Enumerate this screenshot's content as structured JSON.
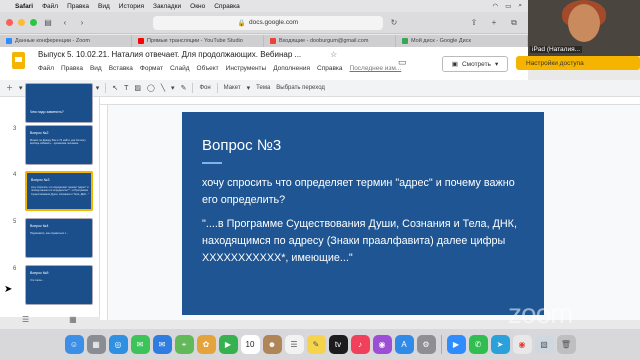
{
  "menubar": {
    "apple": "",
    "app": "Safari",
    "items": [
      "Файл",
      "Правка",
      "Вид",
      "История",
      "Закладки",
      "Окно",
      "Справка"
    ]
  },
  "safari": {
    "url": "docs.google.com",
    "lock_icon": "lock-icon"
  },
  "tabs": [
    {
      "label": "Данные конференции - Zoom",
      "color": "#2d8cff"
    },
    {
      "label": "Прямые трансляции - YouTube Studio",
      "color": "#ff0000"
    },
    {
      "label": "Входящие - dooburgum@gmail.com",
      "color": "#ea4335"
    },
    {
      "label": "Мой диск - Google Диск",
      "color": "#34a853"
    }
  ],
  "docs": {
    "title": "Выпуск 5. 10.02.21. Наталия отвечает. Для продолжающих. Вебинар ...",
    "menus": [
      "Файл",
      "Правка",
      "Вид",
      "Вставка",
      "Формат",
      "Слайд",
      "Объект",
      "Инструменты",
      "Дополнения",
      "Справка"
    ],
    "last_edit": "Последнее изм...",
    "view_button": "Смотреть",
    "access_button": "Настройки доступа"
  },
  "toolbar": {
    "background": "Фон",
    "layout": "Макет",
    "theme": "Тема",
    "transition": "Выбрать переход"
  },
  "filmstrip": {
    "slides": [
      {
        "num": "",
        "title": "",
        "body": "Чем надо заменить?",
        "selected": false
      },
      {
        "num": "3",
        "title": "Вопрос №2",
        "body": "Можно ли Дэвиду Бок и 72 найти, как Ом могу вообще избавить... организма человека.",
        "selected": false
      },
      {
        "num": "4",
        "title": "Вопрос №3",
        "body": "хочу спросить что определяет термин \"адрес\" и почему важно его определить? \"...в Программе Существования Души, Сознания и Тела, ДНК...\"",
        "selected": true
      },
      {
        "num": "5",
        "title": "Вопрос №4",
        "body": "Подскажите, как справиться с...",
        "selected": false
      },
      {
        "num": "6",
        "title": "Вопрос №5",
        "body": "Что такое...",
        "selected": false
      }
    ]
  },
  "slide": {
    "title": "Вопрос №3",
    "question": "хочу спросить что определяет термин \"адрес\" и почему важно его определить?",
    "answer": "\"....в Программе Существования Души, Сознания и Тела, ДНК, находящимся по адресу (Знаки праалфавита) далее цифры ХХХХХХХХХХХ*, имеющие...\""
  },
  "camera": {
    "name": "iPad (Наталия..."
  },
  "watermark": "zoom",
  "dock": {
    "calendar_day": "10",
    "apps": [
      {
        "name": "finder",
        "color": "#3b8fe6",
        "badge": ""
      },
      {
        "name": "launchpad",
        "color": "#8a8d93",
        "badge": ""
      },
      {
        "name": "safari",
        "color": "#2f8fe0",
        "badge": ""
      },
      {
        "name": "messages",
        "color": "#3cc35a",
        "badge": ""
      },
      {
        "name": "mail",
        "color": "#2f7de0",
        "badge": ""
      },
      {
        "name": "maps",
        "color": "#61b95a",
        "badge": ""
      },
      {
        "name": "photos",
        "color": "#e5a33c",
        "badge": ""
      },
      {
        "name": "facetime",
        "color": "#37b14f",
        "badge": ""
      },
      {
        "name": "calendar",
        "color": "#ffffff",
        "badge": ""
      },
      {
        "name": "contacts",
        "color": "#b08659",
        "badge": ""
      },
      {
        "name": "reminders",
        "color": "#f2f2f2",
        "badge": ""
      },
      {
        "name": "notes",
        "color": "#f5d34a",
        "badge": ""
      },
      {
        "name": "tv",
        "color": "#1c1c1e",
        "badge": ""
      },
      {
        "name": "music",
        "color": "#f2405b",
        "badge": ""
      },
      {
        "name": "podcasts",
        "color": "#9d4ed6",
        "badge": ""
      },
      {
        "name": "appstore",
        "color": "#2f8ae8",
        "badge": ""
      },
      {
        "name": "settings",
        "color": "#8e8e93",
        "badge": ""
      },
      {
        "name": "zoom",
        "color": "#2d8cff",
        "badge": ""
      },
      {
        "name": "whatsapp",
        "color": "#2fbe4f",
        "badge": ""
      },
      {
        "name": "telegram",
        "color": "#2aa1da",
        "badge": ""
      },
      {
        "name": "chrome",
        "color": "#e8e8e8",
        "badge": ""
      },
      {
        "name": "preview",
        "color": "#cfd8e0",
        "badge": ""
      },
      {
        "name": "trash",
        "color": "#bfbfc2",
        "badge": ""
      }
    ]
  }
}
